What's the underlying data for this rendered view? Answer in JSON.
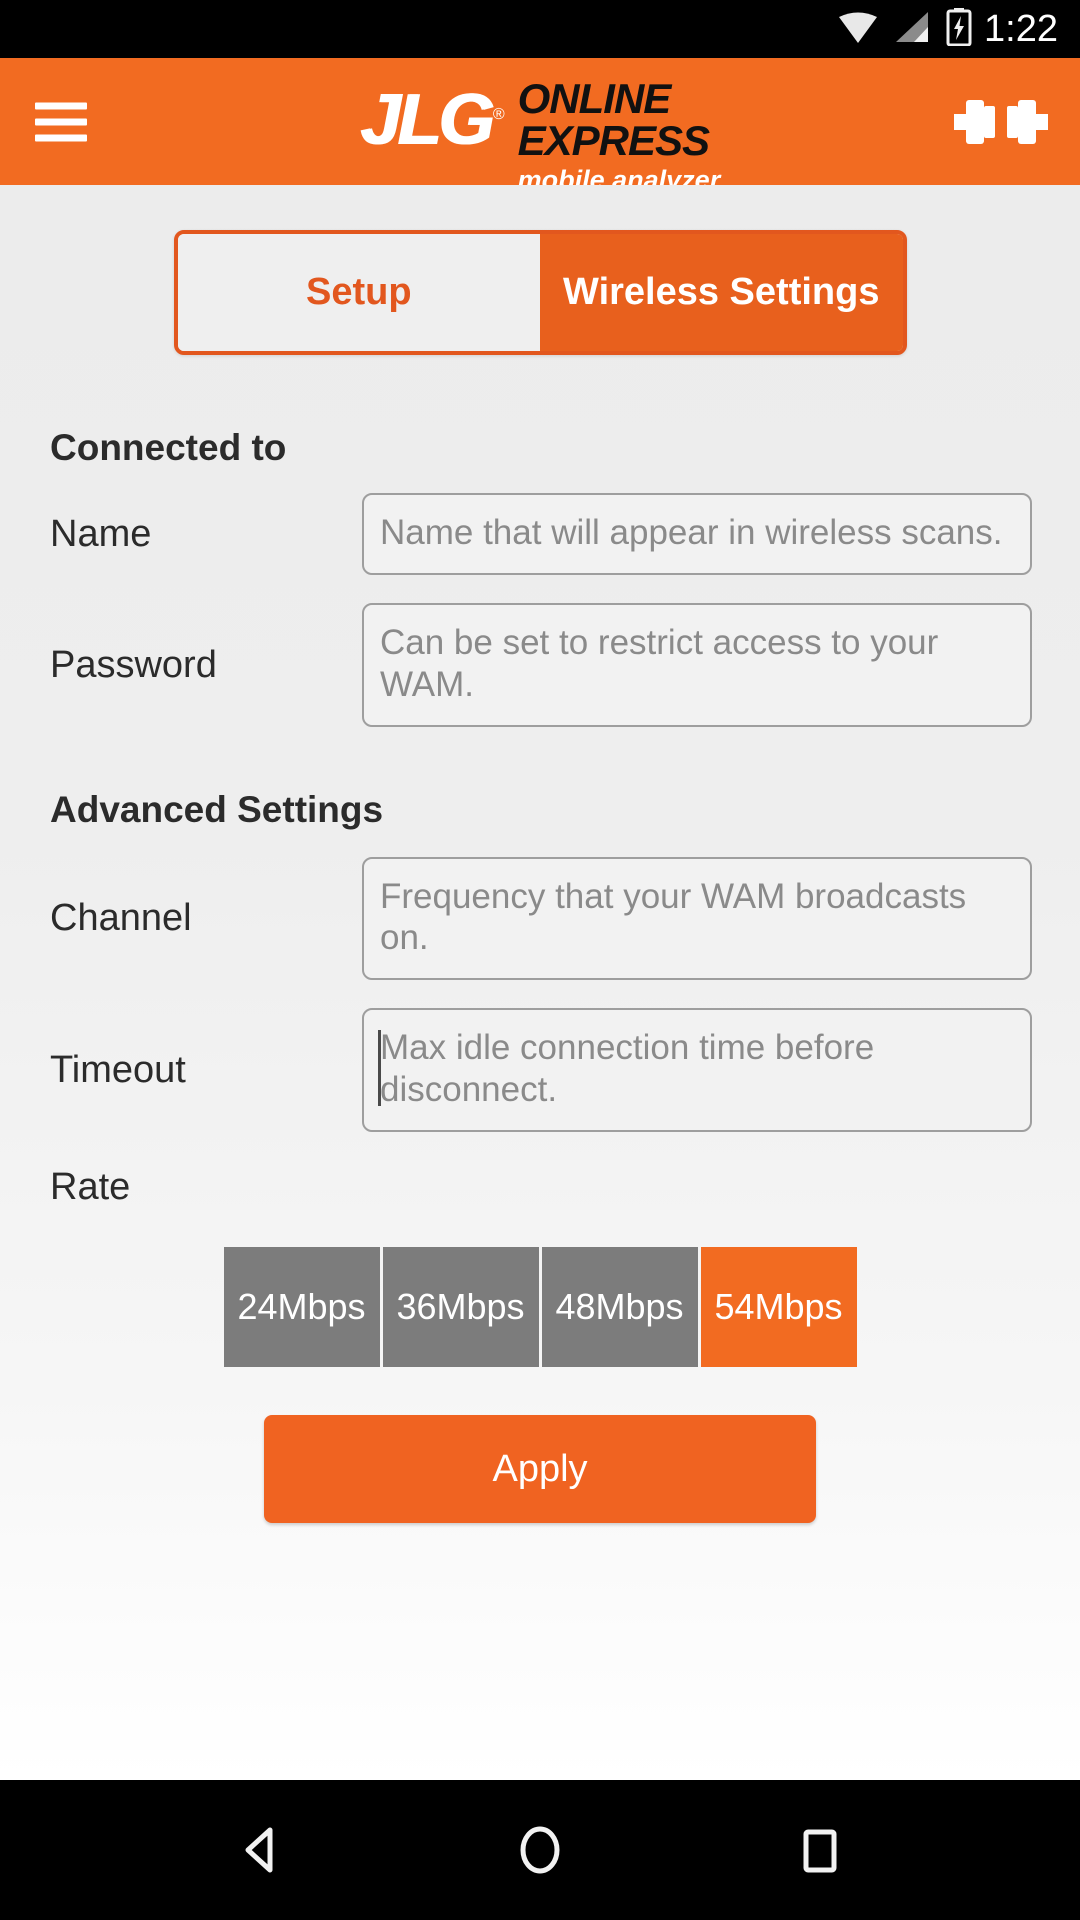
{
  "status_bar": {
    "time": "1:22",
    "icons": [
      "wifi-icon",
      "cell-signal-icon",
      "battery-charging-icon"
    ]
  },
  "header": {
    "menu_icon": "hamburger-menu-icon",
    "logo_text": "JLG",
    "logo_registered": "®",
    "title_line1": "ONLINE",
    "title_line2": "EXPRESS",
    "subtitle": "mobile analyzer",
    "right_icon": "dumbbell-icon",
    "background_color": "#F26B21"
  },
  "tabs": [
    {
      "label": "Setup",
      "active": false
    },
    {
      "label": "Wireless Settings",
      "active": true
    }
  ],
  "sections": [
    {
      "title": "Connected to",
      "rows": [
        {
          "label": "Name",
          "placeholder": "Name that will appear in wireless scans.",
          "value": "",
          "focused": false
        },
        {
          "label": "Password",
          "placeholder": "Can be set to restrict access to your WAM.",
          "value": "",
          "focused": false
        }
      ]
    },
    {
      "title": "Advanced Settings",
      "rows": [
        {
          "label": "Channel",
          "placeholder": "Frequency that your WAM broadcasts on.",
          "value": "",
          "focused": false
        },
        {
          "label": "Timeout",
          "placeholder": "Max idle connection time before disconnect.",
          "value": "",
          "focused": true
        }
      ]
    }
  ],
  "rate": {
    "label": "Rate",
    "options": [
      {
        "label": "24Mbps",
        "selected": false
      },
      {
        "label": "36Mbps",
        "selected": false
      },
      {
        "label": "48Mbps",
        "selected": false
      },
      {
        "label": "54Mbps",
        "selected": true
      }
    ]
  },
  "apply": {
    "label": "Apply"
  },
  "navbar": {
    "back": "back-triangle-icon",
    "home": "home-circle-icon",
    "recents": "recents-square-icon"
  },
  "colors": {
    "brand_orange": "#F26B21",
    "tab_border": "#E2571E",
    "rate_inactive": "#7c7c7c",
    "page_bg": "#eeeeee"
  }
}
